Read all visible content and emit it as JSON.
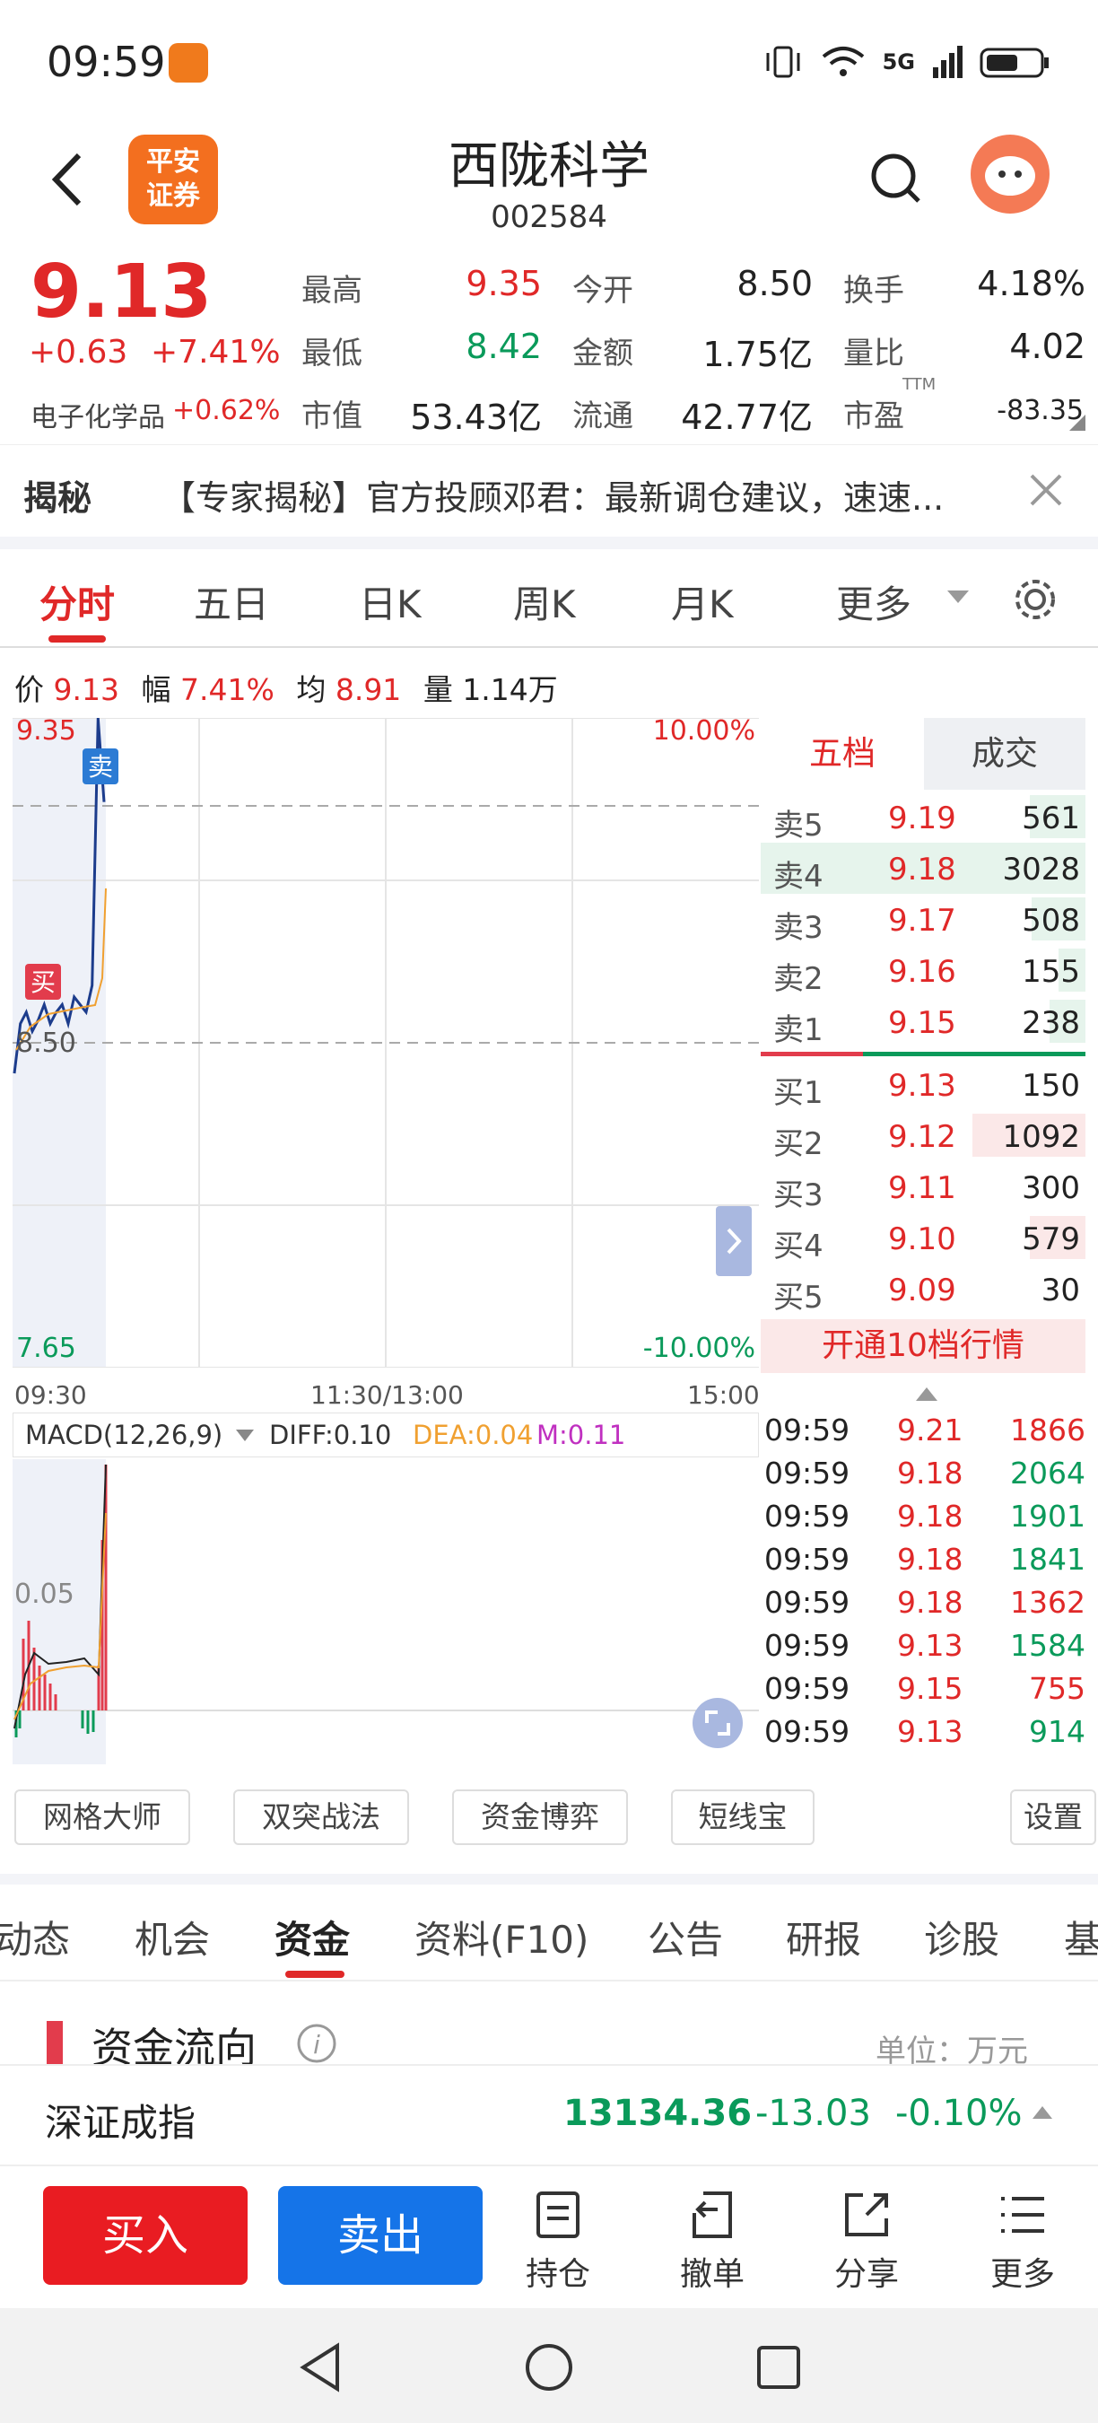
{
  "status_bar": {
    "time": "09:59",
    "network": "5G"
  },
  "header": {
    "title": "西陇科学",
    "code": "002584",
    "logo_text": "平安\n证券"
  },
  "quote": {
    "price": "9.13",
    "change": "+0.63",
    "change_pct": "+7.41%",
    "sector": "电子化学品",
    "sector_pct": "+0.62%",
    "cells": [
      {
        "label": "最高",
        "value": "9.35"
      },
      {
        "label": "今开",
        "value": "8.50"
      },
      {
        "label": "换手",
        "value": "4.18%"
      },
      {
        "label": "最低",
        "value": "8.42"
      },
      {
        "label": "金额",
        "value": "1.75亿"
      },
      {
        "label": "量比",
        "value": "4.02"
      },
      {
        "label": "市值",
        "value": "53.43亿"
      },
      {
        "label": "流通",
        "value": "42.77亿"
      },
      {
        "label": "市盈",
        "value": "-83.35",
        "sup": "TTM"
      }
    ]
  },
  "banner": {
    "tag": "揭秘",
    "text": "【专家揭秘】官方投顾邓君：最新调仓建议，速速..."
  },
  "chart_tabs": [
    "分时",
    "五日",
    "日K",
    "周K",
    "月K",
    "更多"
  ],
  "info_line": {
    "price_label": "价",
    "price": "9.13",
    "amp_label": "幅",
    "amp": "7.41%",
    "avg_label": "均",
    "avg": "8.91",
    "vol_label": "量",
    "vol": "1.14万"
  },
  "chart_data": {
    "type": "line",
    "title": "",
    "y_top": "9.35",
    "y_mid": "8.50",
    "y_bottom": "7.65",
    "pct_top": "10.00%",
    "pct_bottom": "-10.00%",
    "x_labels": [
      "09:30",
      "11:30/13:00",
      "15:00"
    ],
    "ylim": [
      7.65,
      9.35
    ],
    "series": [
      {
        "values": [
          8.42,
          8.55,
          8.58,
          8.53,
          8.56,
          8.6,
          8.55,
          8.58,
          8.6,
          8.55,
          8.62,
          8.6,
          8.58,
          8.65,
          9.35,
          9.13
        ]
      }
    ],
    "markers": {
      "sell": "卖",
      "buy": "买"
    }
  },
  "macd": {
    "label": "MACD(12,26,9)",
    "diff": "DIFF:0.10",
    "dea": "DEA:0.04",
    "m": "M:0.11",
    "level": "0.05"
  },
  "order_book": {
    "tabs": [
      "五档",
      "成交"
    ],
    "sells": [
      {
        "label": "卖5",
        "price": "9.19",
        "vol": "561"
      },
      {
        "label": "卖4",
        "price": "9.18",
        "vol": "3028"
      },
      {
        "label": "卖3",
        "price": "9.17",
        "vol": "508"
      },
      {
        "label": "卖2",
        "price": "9.16",
        "vol": "155"
      },
      {
        "label": "卖1",
        "price": "9.15",
        "vol": "238"
      }
    ],
    "buys": [
      {
        "label": "买1",
        "price": "9.13",
        "vol": "150"
      },
      {
        "label": "买2",
        "price": "9.12",
        "vol": "1092"
      },
      {
        "label": "买3",
        "price": "9.11",
        "vol": "300"
      },
      {
        "label": "买4",
        "price": "9.10",
        "vol": "579"
      },
      {
        "label": "买5",
        "price": "9.09",
        "vol": "30"
      }
    ],
    "open_btn": "开通10档行情"
  },
  "trades": [
    {
      "time": "09:59",
      "price": "9.21",
      "vol": "1866",
      "dir": "red"
    },
    {
      "time": "09:59",
      "price": "9.18",
      "vol": "2064",
      "dir": "green"
    },
    {
      "time": "09:59",
      "price": "9.18",
      "vol": "1901",
      "dir": "green"
    },
    {
      "time": "09:59",
      "price": "9.18",
      "vol": "1841",
      "dir": "green"
    },
    {
      "time": "09:59",
      "price": "9.18",
      "vol": "1362",
      "dir": "red"
    },
    {
      "time": "09:59",
      "price": "9.13",
      "vol": "1584",
      "dir": "green"
    },
    {
      "time": "09:59",
      "price": "9.15",
      "vol": "755",
      "dir": "red"
    },
    {
      "time": "09:59",
      "price": "9.13",
      "vol": "914",
      "dir": "green"
    }
  ],
  "tools": [
    "网格大师",
    "双突战法",
    "资金博弈",
    "短线宝",
    "设置"
  ],
  "bottom_tabs": [
    "动态",
    "机会",
    "资金",
    "资料(F10)",
    "公告",
    "研报",
    "诊股",
    "基"
  ],
  "fund_flow": {
    "title": "资金流向",
    "unit": "单位：万元"
  },
  "index": {
    "name": "深证成指",
    "value": "13134.36",
    "change": "-13.03",
    "pct": "-0.10%"
  },
  "actions": {
    "buy": "买入",
    "sell": "卖出",
    "items": [
      "持仓",
      "撤单",
      "分享",
      "更多"
    ]
  }
}
